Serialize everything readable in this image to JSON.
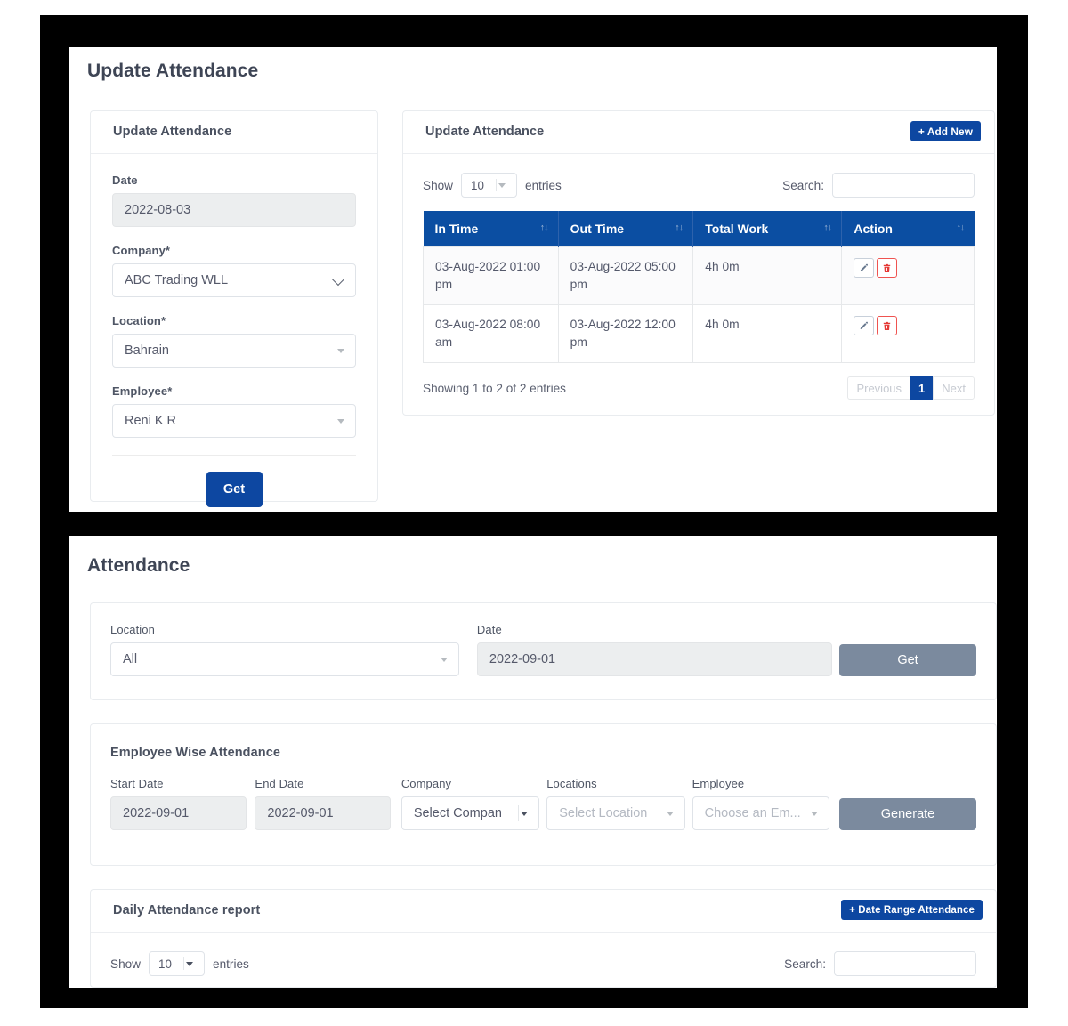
{
  "update_section": {
    "page_title": "Update Attendance",
    "form_panel": {
      "title": "Update Attendance",
      "fields": {
        "date_label": "Date",
        "date_value": "2022-08-03",
        "company_label": "Company*",
        "company_value": "ABC Trading WLL",
        "location_label": "Location*",
        "location_value": "Bahrain",
        "employee_label": "Employee*",
        "employee_value": "Reni K R"
      },
      "get_button": "Get"
    },
    "table_panel": {
      "title": "Update Attendance",
      "add_new_button": "+ Add New",
      "show_label": "Show",
      "entries_label": "entries",
      "page_length": "10",
      "search_label": "Search:",
      "search_value": "",
      "columns": [
        "In Time",
        "Out Time",
        "Total Work",
        "Action"
      ],
      "rows": [
        {
          "in_time": "03-Aug-2022 01:00 pm",
          "out_time": "03-Aug-2022 05:00 pm",
          "total_work": "4h 0m"
        },
        {
          "in_time": "03-Aug-2022 08:00 am",
          "out_time": "03-Aug-2022 12:00 pm",
          "total_work": "4h 0m"
        }
      ],
      "info": "Showing 1 to 2 of 2 entries",
      "pagination": {
        "previous": "Previous",
        "pages": [
          "1"
        ],
        "next": "Next",
        "active": "1"
      },
      "row_actions": {
        "edit_icon": "pencil-icon",
        "delete_icon": "trash-icon"
      }
    }
  },
  "attendance_section": {
    "page_title": "Attendance",
    "filter_panel": {
      "location_label": "Location",
      "location_value": "All",
      "date_label": "Date",
      "date_value": "2022-09-01",
      "get_button": "Get"
    },
    "employee_wise_panel": {
      "title": "Employee Wise Attendance",
      "start_date_label": "Start Date",
      "start_date_value": "2022-09-01",
      "end_date_label": "End Date",
      "end_date_value": "2022-09-01",
      "company_label": "Company",
      "company_placeholder": "Select Compan",
      "locations_label": "Locations",
      "locations_placeholder": "Select Location",
      "employee_label": "Employee",
      "employee_placeholder": "Choose an Em...",
      "generate_button": "Generate"
    },
    "daily_panel": {
      "title": "Daily Attendance report",
      "date_range_button": "+ Date Range Attendance",
      "show_label": "Show",
      "entries_label": "entries",
      "page_length": "10",
      "search_label": "Search:",
      "search_value": ""
    }
  },
  "colors": {
    "primary_blue": "#0d47a1",
    "table_header_blue": "#0b4ea2",
    "grey_button": "#7b8a9e",
    "danger_red": "#ef5350",
    "frame_black": "#000000"
  }
}
